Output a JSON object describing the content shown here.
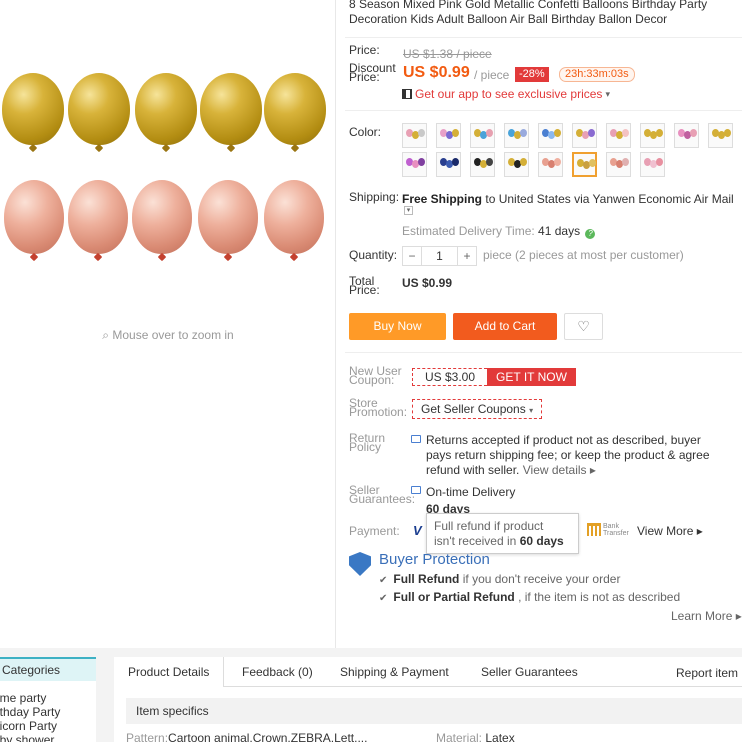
{
  "product": {
    "title": "8 Season Mixed Pink Gold Metallic Confetti Balloons Birthday Party Decoration Kids Adult Balloon Air Ball Birthday Ballon Decor",
    "zoom_hint": "Mouse over to zoom in",
    "image_icon": "magnifier-icon"
  },
  "price": {
    "label": "Price:",
    "old": "US $1.38 / piece",
    "discount_label": "Discount Price:",
    "current": "US $0.99",
    "per": "/ piece",
    "discount_badge": "-28%",
    "timer": "23h:33m:03s",
    "app_promo": "Get our app to see exclusive prices",
    "app_promo_arrow": "▾"
  },
  "color": {
    "label": "Color:",
    "selected_index": 15
  },
  "shipping": {
    "label": "Shipping:",
    "free": "Free Shipping",
    "to": "to",
    "destination": "United States via Yanwen Economic Air Mail",
    "dropdown_glyph": "▾",
    "eta_label": "Estimated Delivery Time:",
    "eta_value": "41 days",
    "eta_icon_glyph": "?"
  },
  "quantity": {
    "label": "Quantity:",
    "minus": "−",
    "value": "1",
    "plus": "+",
    "note": "piece (2 pieces at most per customer)"
  },
  "total": {
    "label": "Total Price:",
    "value": "US $0.99"
  },
  "actions": {
    "buy": "Buy Now",
    "cart": "Add to Cart",
    "wish_glyph": "♡"
  },
  "coupon": {
    "label": "New User Coupon:",
    "amount": "US $3.00",
    "get": "GET IT NOW"
  },
  "store_promo": {
    "label": "Store Promotion:",
    "button": "Get Seller Coupons",
    "arrow": "▾"
  },
  "return_policy": {
    "label": "Return Policy",
    "text": "Returns accepted if product not as described, buyer pays return shipping fee; or keep the product & agree refund with seller.",
    "link": "View details ▸"
  },
  "guarantees": {
    "label": "Seller Guarantees:",
    "on_time": "On-time Delivery",
    "days": "60 days"
  },
  "tooltip": {
    "line1": "Full refund if product",
    "line2_pre": "isn't received in",
    "line2_bold": "60 days"
  },
  "payment": {
    "label": "Payment:",
    "visa": "V",
    "bank_line1": "Bank",
    "bank_line2": "Transfer",
    "view_more": "View More ▸"
  },
  "buyer_protection": {
    "title": "Buyer Protection",
    "check_glyph": "✔",
    "line1_bold": "Full Refund",
    "line1": "if you don't receive your order",
    "line2_bold": "Full or Partial Refund",
    "line2": ", if the item is not as described",
    "learn_more": "Learn More ▸"
  },
  "categories": {
    "title": "Categories",
    "items": [
      "eme party",
      "irthday Party",
      "nicorn Party",
      "aby shower"
    ]
  },
  "tabs": {
    "items": [
      "Product Details",
      "Feedback (0)",
      "Shipping & Payment",
      "Seller Guarantees"
    ],
    "report": "Report item"
  },
  "specs": {
    "title": "Item specifics",
    "pattern_label": "Pattern:",
    "pattern_value": "Cartoon animal,Crown,ZEBRA,Lett....",
    "material_label": "Material:",
    "material_value": "Latex"
  }
}
